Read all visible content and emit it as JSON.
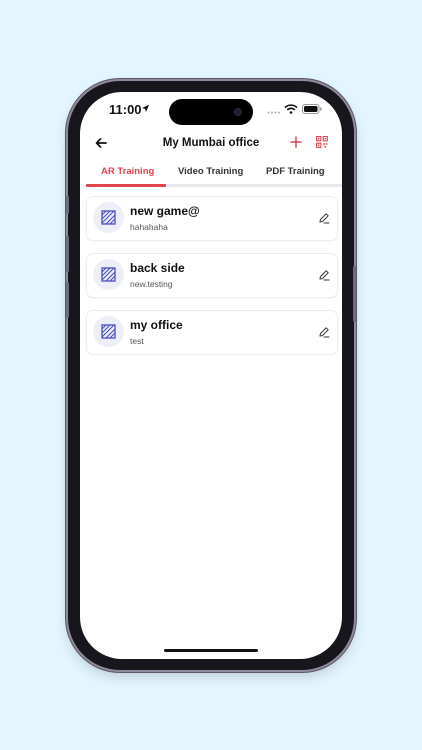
{
  "status_bar": {
    "time": "11:00"
  },
  "header": {
    "title": "My Mumbai office"
  },
  "tabs": [
    {
      "label": "AR Training",
      "active": true
    },
    {
      "label": "Video Training",
      "active": false
    },
    {
      "label": "PDF Training",
      "active": false
    }
  ],
  "items": [
    {
      "title": "new game@",
      "subtitle": "hahahaha"
    },
    {
      "title": "back side",
      "subtitle": "new.testing"
    },
    {
      "title": "my office",
      "subtitle": "test"
    }
  ],
  "colors": {
    "accent": "#e0444c",
    "icon": "#4b4fbf",
    "background": "#e3f6fe"
  },
  "icons": [
    "location-arrow-icon",
    "wifi-icon",
    "battery-icon",
    "back-arrow-icon",
    "plus-icon",
    "qr-code-icon",
    "ar-model-icon",
    "edit-pencil-icon"
  ]
}
